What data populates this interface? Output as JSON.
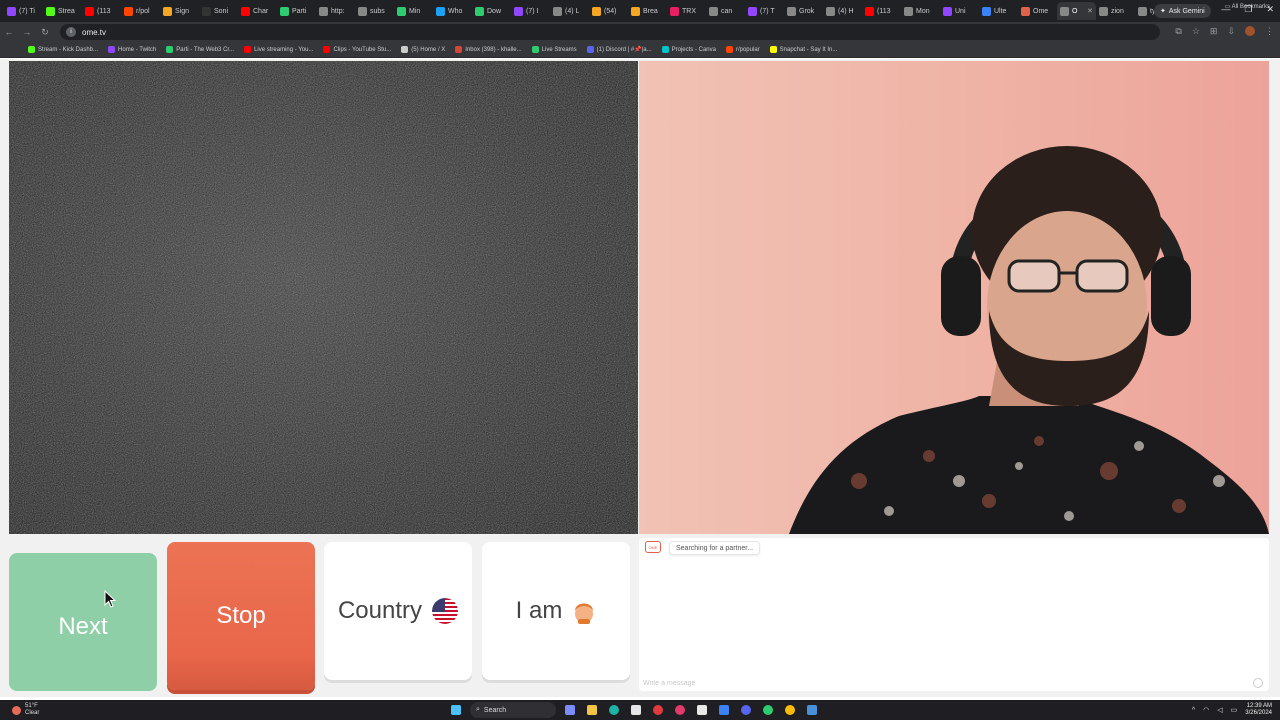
{
  "browser": {
    "tabs": [
      {
        "label": "(7) Ti",
        "color": "#9146ff"
      },
      {
        "label": "Strea",
        "color": "#53fc18"
      },
      {
        "label": "(113",
        "color": "#ff0000"
      },
      {
        "label": "r/pol",
        "color": "#ff4500"
      },
      {
        "label": "Sign",
        "color": "#f5a623"
      },
      {
        "label": "Soni",
        "color": "#333333"
      },
      {
        "label": "Char",
        "color": "#ff0000"
      },
      {
        "label": "Parti",
        "color": "#2ecc71"
      },
      {
        "label": "http:",
        "color": "#888888"
      },
      {
        "label": "subs",
        "color": "#888888"
      },
      {
        "label": "Min",
        "color": "#2ecc71"
      },
      {
        "label": "Who",
        "color": "#1da1f2"
      },
      {
        "label": "Dow",
        "color": "#2ecc71"
      },
      {
        "label": "(7) I",
        "color": "#9146ff"
      },
      {
        "label": "(4) L",
        "color": "#888888"
      },
      {
        "label": "(54)",
        "color": "#f5a623"
      },
      {
        "label": "Brea",
        "color": "#f5a623"
      },
      {
        "label": "TRX",
        "color": "#e91e63"
      },
      {
        "label": "can",
        "color": "#888888"
      },
      {
        "label": "(7) T",
        "color": "#9146ff"
      },
      {
        "label": "Grok",
        "color": "#888888"
      },
      {
        "label": "(4) H",
        "color": "#888888"
      },
      {
        "label": "(113",
        "color": "#ff0000"
      },
      {
        "label": "Mon",
        "color": "#888888"
      },
      {
        "label": "Uni",
        "color": "#9146ff"
      },
      {
        "label": "Ulte",
        "color": "#3b82f6"
      },
      {
        "label": "Ome",
        "color": "#e1614a"
      },
      {
        "label": "O",
        "color": "#888888",
        "active": true
      },
      {
        "label": "zion",
        "color": "#888888"
      },
      {
        "label": "tyttl",
        "color": "#888888"
      }
    ],
    "new_tab": "+",
    "gemini_label": "Ask Gemini",
    "url": "ome.tv",
    "bookmarks": [
      {
        "label": "Stream - Kick Dashb...",
        "color": "#53fc18"
      },
      {
        "label": "Home - Twitch",
        "color": "#9146ff"
      },
      {
        "label": "Parti - The Web3 Cr...",
        "color": "#2ecc71"
      },
      {
        "label": "Live streaming - You...",
        "color": "#ff0000"
      },
      {
        "label": "Clips - YouTube Stu...",
        "color": "#ff0000"
      },
      {
        "label": "(5) Home / X",
        "color": "#cccccc"
      },
      {
        "label": "Inbox (398) - khalle...",
        "color": "#d44638"
      },
      {
        "label": "Live Streams",
        "color": "#2ecc71"
      },
      {
        "label": "(1) Discord | #📌|a...",
        "color": "#5865f2"
      },
      {
        "label": "Projects - Canva",
        "color": "#00c4cc"
      },
      {
        "label": "r/popular",
        "color": "#ff4500"
      },
      {
        "label": "Snapchat - Say It In...",
        "color": "#fffc00"
      }
    ],
    "all_bookmarks": "All Bookmarks"
  },
  "controls": {
    "next_label": "Next",
    "stop_label": "Stop",
    "country_label": "Country",
    "country_flag": "us-flag-icon",
    "iam_label": "I am",
    "iam_icon": "kid-icon"
  },
  "chat": {
    "status": "Searching for a partner...",
    "input_placeholder": "Write a message"
  },
  "taskbar": {
    "weather_temp": "51°F",
    "weather_desc": "Clear",
    "search_label": "Search",
    "time": "12:39 AM",
    "date": "3/26/2024"
  },
  "colors": {
    "next": "#8fcfa7",
    "stop": "#ea6b4f",
    "accent": "#e1614a"
  }
}
